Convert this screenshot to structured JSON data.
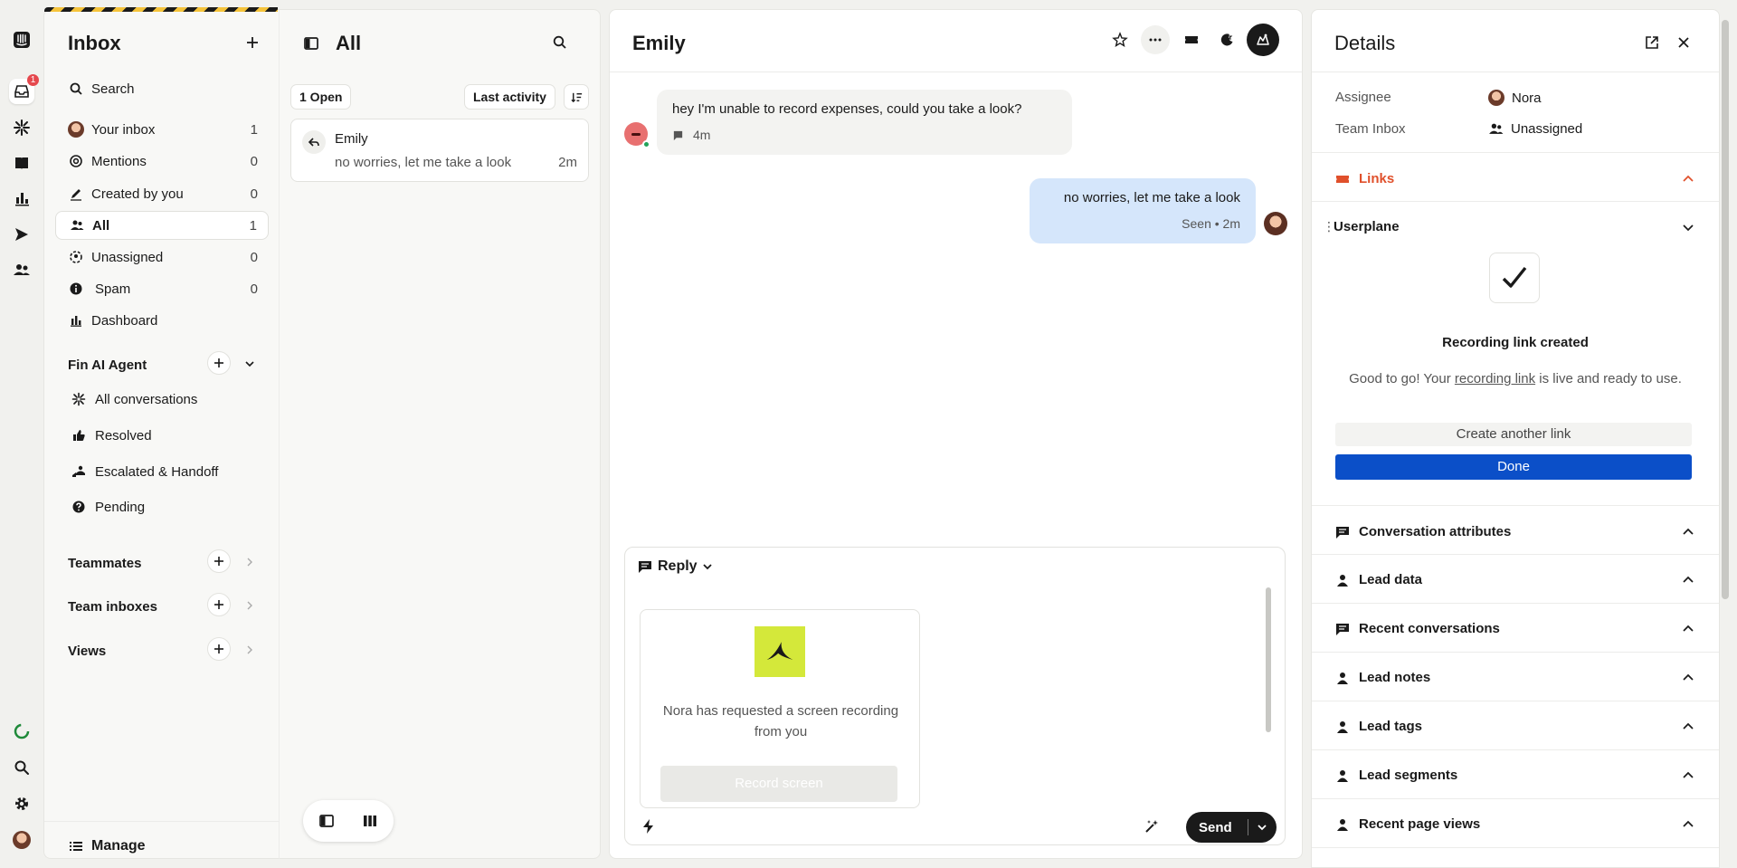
{
  "colors": {
    "accent_blue": "#0b4fc8",
    "links_red": "#e0502b",
    "bubble_out": "#d5e6fb",
    "badge_red": "#e5484d"
  },
  "rail": {
    "inbox_badge": "1"
  },
  "inbox": {
    "title": "Inbox",
    "search_label": "Search",
    "items": [
      {
        "label": "Your inbox",
        "count": "1"
      },
      {
        "label": "Mentions",
        "count": "0"
      },
      {
        "label": "Created by you",
        "count": "0"
      },
      {
        "label": "All",
        "count": "1"
      },
      {
        "label": "Unassigned",
        "count": "0"
      },
      {
        "label": "Spam",
        "count": "0"
      },
      {
        "label": "Dashboard",
        "count": ""
      }
    ],
    "fin": {
      "title": "Fin AI Agent",
      "items": [
        "All conversations",
        "Resolved",
        "Escalated & Handoff",
        "Pending"
      ]
    },
    "teammates": "Teammates",
    "team_inboxes": "Team inboxes",
    "views": "Views",
    "manage": "Manage"
  },
  "list": {
    "title": "All",
    "open_filter": "1 Open",
    "sort_label": "Last activity",
    "card": {
      "name": "Emily",
      "preview": "no worries, let me take a look",
      "time": "2m"
    }
  },
  "conversation": {
    "title": "Emily",
    "incoming": {
      "text": "hey I'm unable to record expenses, could you take a look?",
      "time": "4m"
    },
    "outgoing": {
      "text": "no worries, let me take a look",
      "status": "Seen • 2m"
    },
    "composer": {
      "tab": "Reply",
      "request_text": "Nora has requested a screen recording from you",
      "record_button": "Record screen",
      "send": "Send"
    }
  },
  "details": {
    "title": "Details",
    "assignee_label": "Assignee",
    "assignee_value": "Nora",
    "team_inbox_label": "Team Inbox",
    "team_inbox_value": "Unassigned",
    "links_title": "Links",
    "userplane": {
      "title": "Userplane",
      "heading": "Recording link created",
      "text_before": "Good to go! Your ",
      "link_text": "recording link",
      "text_after": " is live and ready to use.",
      "secondary_button": "Create another link",
      "primary_button": "Done"
    },
    "sections": [
      "Conversation attributes",
      "Lead data",
      "Recent conversations",
      "Lead notes",
      "Lead tags",
      "Lead segments",
      "Recent page views"
    ]
  }
}
